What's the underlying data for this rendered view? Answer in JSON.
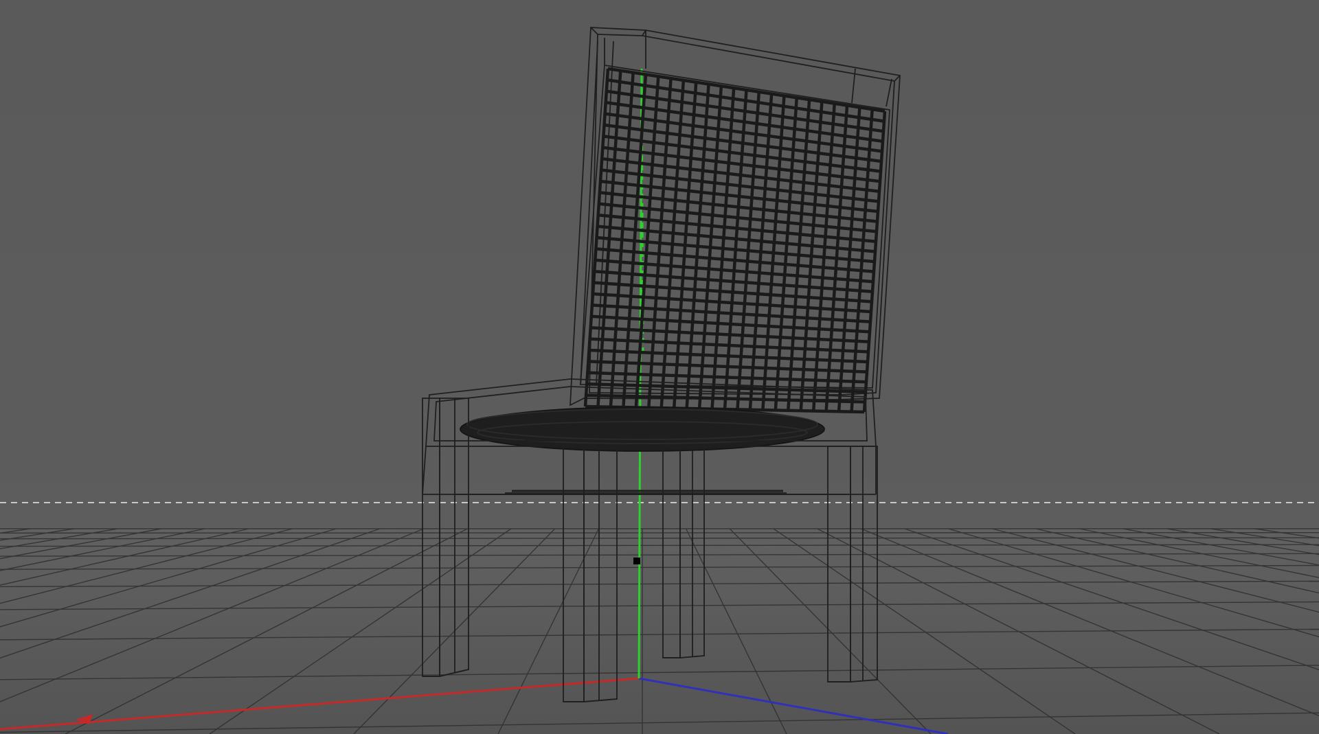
{
  "viewport": {
    "render_mode": "wireframe",
    "object": "chair",
    "colors": {
      "background_top": "#5a5a5a",
      "background_bottom": "#606060",
      "floor": "#565656",
      "grid_line": "#2e2e2e",
      "wire": "#1f1f1f",
      "horizon_dash": "#c8c8c8",
      "axis_x": "#c42a2a",
      "axis_y": "#2ed02e",
      "axis_z": "#3030b8",
      "pivot": "#000000"
    },
    "axes": [
      {
        "name": "x-axis",
        "color_key": "axis_x"
      },
      {
        "name": "y-axis",
        "color_key": "axis_y"
      },
      {
        "name": "z-axis",
        "color_key": "axis_z"
      }
    ],
    "show_ground_grid": true,
    "show_horizon_line": true
  }
}
